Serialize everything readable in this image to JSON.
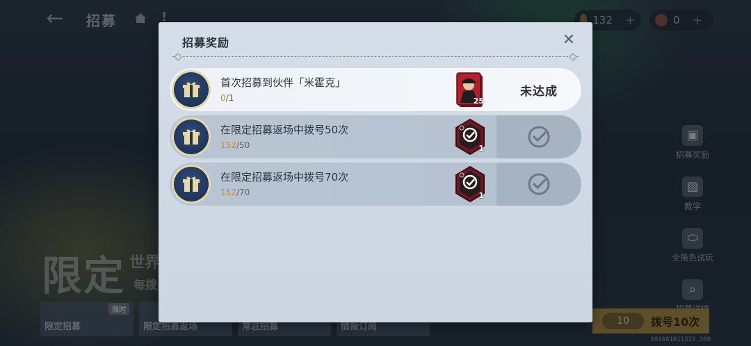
{
  "screen": {
    "title": "招募",
    "back_icon": "back-arrow-icon",
    "home_icon": "home-icon",
    "alert_icon": "alert-icon",
    "alert_symbol": "!",
    "currencies": [
      {
        "icon": "currency-coin-icon",
        "amount": "132",
        "plus": "+"
      },
      {
        "icon": "currency-ticket-icon",
        "amount": "0",
        "plus": "+"
      }
    ]
  },
  "right_menu": [
    {
      "label": "招募奖励",
      "icon": "gift-icon"
    },
    {
      "label": "教学",
      "icon": "book-icon"
    },
    {
      "label": "全角色试玩",
      "icon": "gamepad-icon"
    },
    {
      "label": "招募详情",
      "icon": "magnifier-icon"
    }
  ],
  "banner": {
    "title": "限定",
    "subtitle": "世界",
    "subtitle2": "每拨"
  },
  "bottom_tabs": [
    {
      "label": "限定招募",
      "tag": "限时"
    },
    {
      "label": "限定招募返场",
      "tag": ""
    },
    {
      "label": "常驻招募",
      "tag": ""
    },
    {
      "label": "情报订阅",
      "tag": ""
    }
  ],
  "draw_button": {
    "count": "10",
    "label": "拨号10次"
  },
  "build_id": "101681011325.366",
  "modal": {
    "title": "招募奖励",
    "close_icon": "close-icon",
    "rows": [
      {
        "title": "首次招募到伙伴「米霍克」",
        "progress_current": "0",
        "progress_total": "/1",
        "reward_qty": "25",
        "status": "未达成",
        "claimed": false,
        "highlight": true
      },
      {
        "title": "在限定招募返场中拨号50次",
        "progress_current": "152",
        "progress_total": "/50",
        "reward_qty": "1",
        "status": "",
        "claimed": true,
        "highlight": false
      },
      {
        "title": "在限定招募返场中拨号70次",
        "progress_current": "152",
        "progress_total": "/70",
        "reward_qty": "1",
        "status": "",
        "claimed": true,
        "highlight": false
      }
    ]
  },
  "colors": {
    "accent_progress": "#c98a2a",
    "modal_bg": "#d5dde8",
    "row_bg": "#b9c5d3",
    "row_active_bg": "#f6f8fb",
    "gift_badge": "#1e3459"
  }
}
